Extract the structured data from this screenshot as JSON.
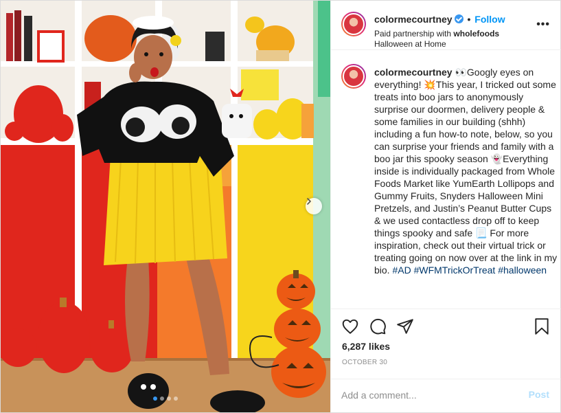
{
  "header": {
    "username": "colormecourtney",
    "separator": "•",
    "follow_label": "Follow",
    "partnership_prefix": "Paid partnership with ",
    "partner": "wholefoods",
    "location": "Halloween at Home",
    "more_label": "•••"
  },
  "caption": {
    "username": "colormecourtney",
    "text": " 👀Googly eyes on everything! 💥This year, I tricked out some treats into boo jars to anonymously surprise our doormen, delivery people & some families in our building (shhh) including a fun how-to note, below, so you can surprise your friends and family with a boo jar this spooky season 👻Everything inside is individually packaged from Whole Foods Market like YumEarth Lollipops and Gummy Fruits, Snyders Halloween Mini Pretzels, and Justin’s Peanut Butter Cups & we used contactless drop off to keep things spooky and safe 📃 For more inspiration, check out their virtual trick or treating going on now over at the link in my bio. ",
    "hashtags": [
      "#AD",
      "#WFMTrickOrTreat",
      "#halloween"
    ]
  },
  "post": {
    "likes": "6,287 likes",
    "date": "OCTOBER 30"
  },
  "comment": {
    "placeholder": "Add a comment...",
    "post_label": "Post"
  },
  "carousel": {
    "slides_total": 4,
    "active_slide": 1
  },
  "icons": {
    "like": "heart-outline-icon",
    "comment": "speech-bubble-icon",
    "share": "paper-plane-icon",
    "save": "bookmark-icon",
    "next": "chevron-right-icon",
    "verified": "verified-badge-icon"
  },
  "colors": {
    "follow": "#0095f6",
    "verified": "#3897f0",
    "hashtag": "#00376b",
    "post_disabled": "#b2dffc",
    "muted": "#8e8e8e"
  }
}
